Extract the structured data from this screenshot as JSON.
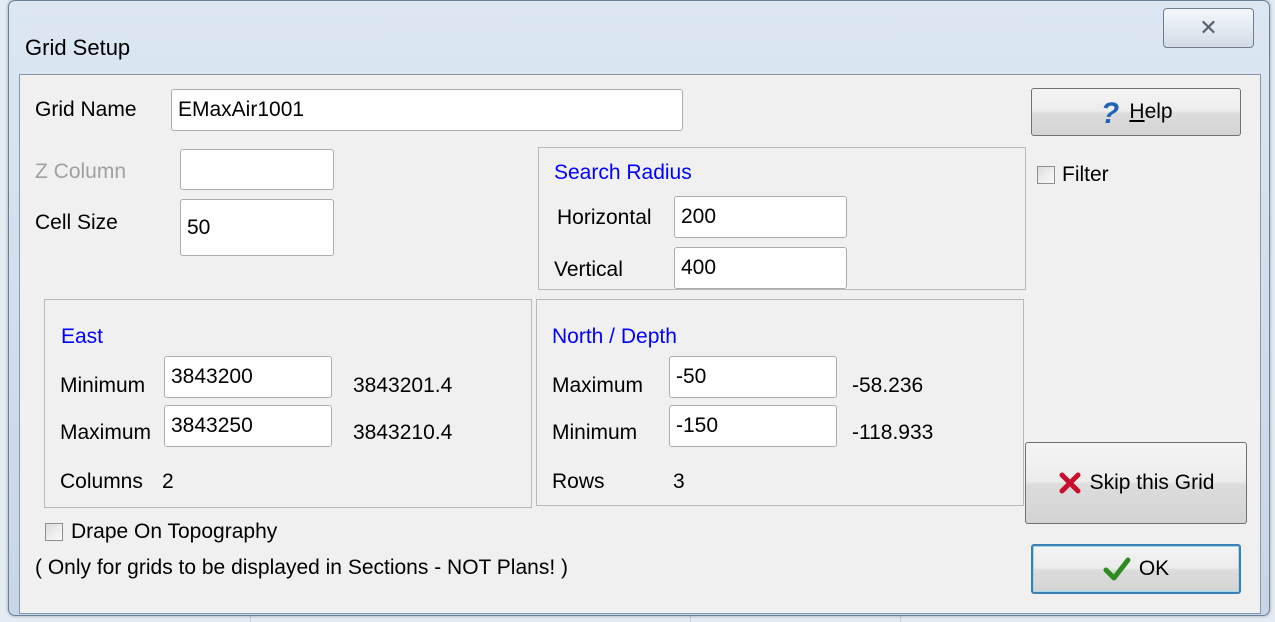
{
  "window": {
    "title": "Grid Setup",
    "close_glyph": "✕"
  },
  "fields": {
    "grid_name": {
      "label": "Grid Name",
      "value": "EMaxAir1001"
    },
    "z_column": {
      "label": "Z Column",
      "value": ""
    },
    "cell_size": {
      "label": "Cell Size",
      "value": "50"
    }
  },
  "search_radius": {
    "title": "Search Radius",
    "horizontal": {
      "label": "Horizontal",
      "value": "200"
    },
    "vertical": {
      "label": "Vertical",
      "value": "400"
    }
  },
  "east": {
    "title": "East",
    "minimum": {
      "label": "Minimum",
      "value": "3843200",
      "computed": "3843201.4"
    },
    "maximum": {
      "label": "Maximum",
      "value": "3843250",
      "computed": "3843210.4"
    },
    "columns": {
      "label": "Columns",
      "value": "2"
    }
  },
  "north": {
    "title": "North / Depth",
    "maximum": {
      "label": "Maximum",
      "value": "-50",
      "computed": "-58.236"
    },
    "minimum": {
      "label": "Minimum",
      "value": "-150",
      "computed": "-118.933"
    },
    "rows": {
      "label": "Rows",
      "value": "3"
    }
  },
  "buttons": {
    "help": {
      "icon": "question-icon",
      "mnemonic": "H",
      "rest": "elp"
    },
    "skip": {
      "icon": "red-x-icon",
      "label": "Skip this Grid"
    },
    "ok": {
      "icon": "green-check-icon",
      "label": "OK"
    }
  },
  "options": {
    "filter": {
      "label": "Filter",
      "checked": false
    },
    "drape": {
      "label": "Drape On Topography",
      "checked": false
    },
    "note": "( Only for grids to be displayed in Sections - NOT Plans! )"
  },
  "colors": {
    "accent_blue": "#0000ff",
    "help_icon": "#1e63b6",
    "skip_icon": "#c8102e",
    "ok_icon": "#2e8b1f"
  }
}
